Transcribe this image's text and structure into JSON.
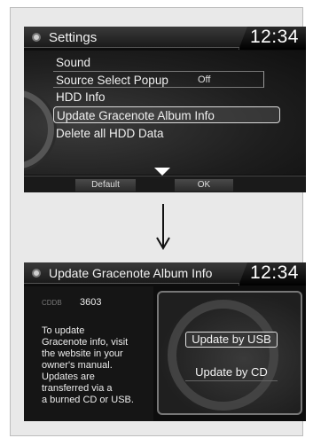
{
  "screen1": {
    "title": "Settings",
    "clock": "12:34",
    "menu": [
      {
        "label": "Sound"
      },
      {
        "label": "Source Select Popup",
        "value": "Off"
      },
      {
        "label": "HDD Info"
      },
      {
        "label": "Update Gracenote Album Info",
        "selected": true
      },
      {
        "label": "Delete all HDD Data"
      }
    ],
    "softkeys": {
      "left": "Default",
      "right": "OK"
    }
  },
  "screen2": {
    "title": "Update Gracenote Album Info",
    "clock": "12:34",
    "cddb_label": "CDDB",
    "cddb_value": "3603",
    "description": "To update\nGracenote info, visit\nthe website in your\nowner's manual.\nUpdates are\ntransferred via a\na burned CD or USB.",
    "options": [
      {
        "label": "Update by USB",
        "selected": true
      },
      {
        "label": "Update by CD"
      }
    ]
  },
  "colors": {
    "screen_bg": "#0d0d0d",
    "text": "#f0f0f0",
    "panel_bg": "#e9e9e9"
  }
}
